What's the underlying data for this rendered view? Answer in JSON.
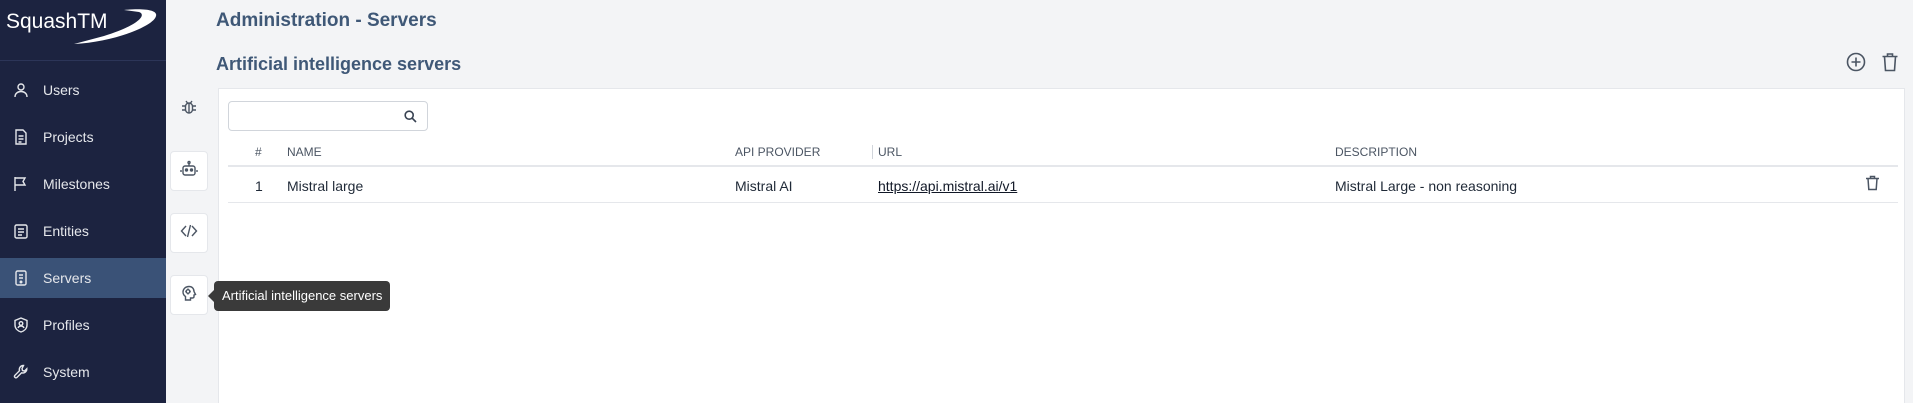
{
  "app": {
    "logo_text": "SquashTM"
  },
  "nav": {
    "items": [
      {
        "label": "Users",
        "icon": "user-icon"
      },
      {
        "label": "Projects",
        "icon": "document-icon"
      },
      {
        "label": "Milestones",
        "icon": "flag-icon"
      },
      {
        "label": "Entities",
        "icon": "clipboard-icon"
      },
      {
        "label": "Servers",
        "icon": "server-icon",
        "active": true
      },
      {
        "label": "Profiles",
        "icon": "shield-user-icon"
      },
      {
        "label": "System",
        "icon": "wrench-icon"
      }
    ]
  },
  "rail": {
    "items": [
      {
        "icon": "bug-icon"
      },
      {
        "icon": "robot-icon"
      },
      {
        "icon": "code-icon"
      },
      {
        "icon": "ai-brain-icon",
        "active": true
      }
    ]
  },
  "header": {
    "page_title": "Administration - Servers",
    "section_title": "Artificial intelligence servers"
  },
  "table": {
    "search_placeholder": "",
    "columns": {
      "num": "#",
      "name": "NAME",
      "api_provider": "API PROVIDER",
      "url": "URL",
      "description": "DESCRIPTION"
    },
    "rows": [
      {
        "num": "1",
        "name": "Mistral large",
        "api_provider": "Mistral AI",
        "url": "https://api.mistral.ai/v1",
        "description": "Mistral Large - non reasoning"
      }
    ]
  },
  "tooltip": {
    "text": "Artificial intelligence servers"
  },
  "colors": {
    "nav_bg": "#1c2340",
    "nav_active": "#3a5277",
    "title": "#3f5877",
    "tooltip_bg": "#3a3a3a"
  }
}
